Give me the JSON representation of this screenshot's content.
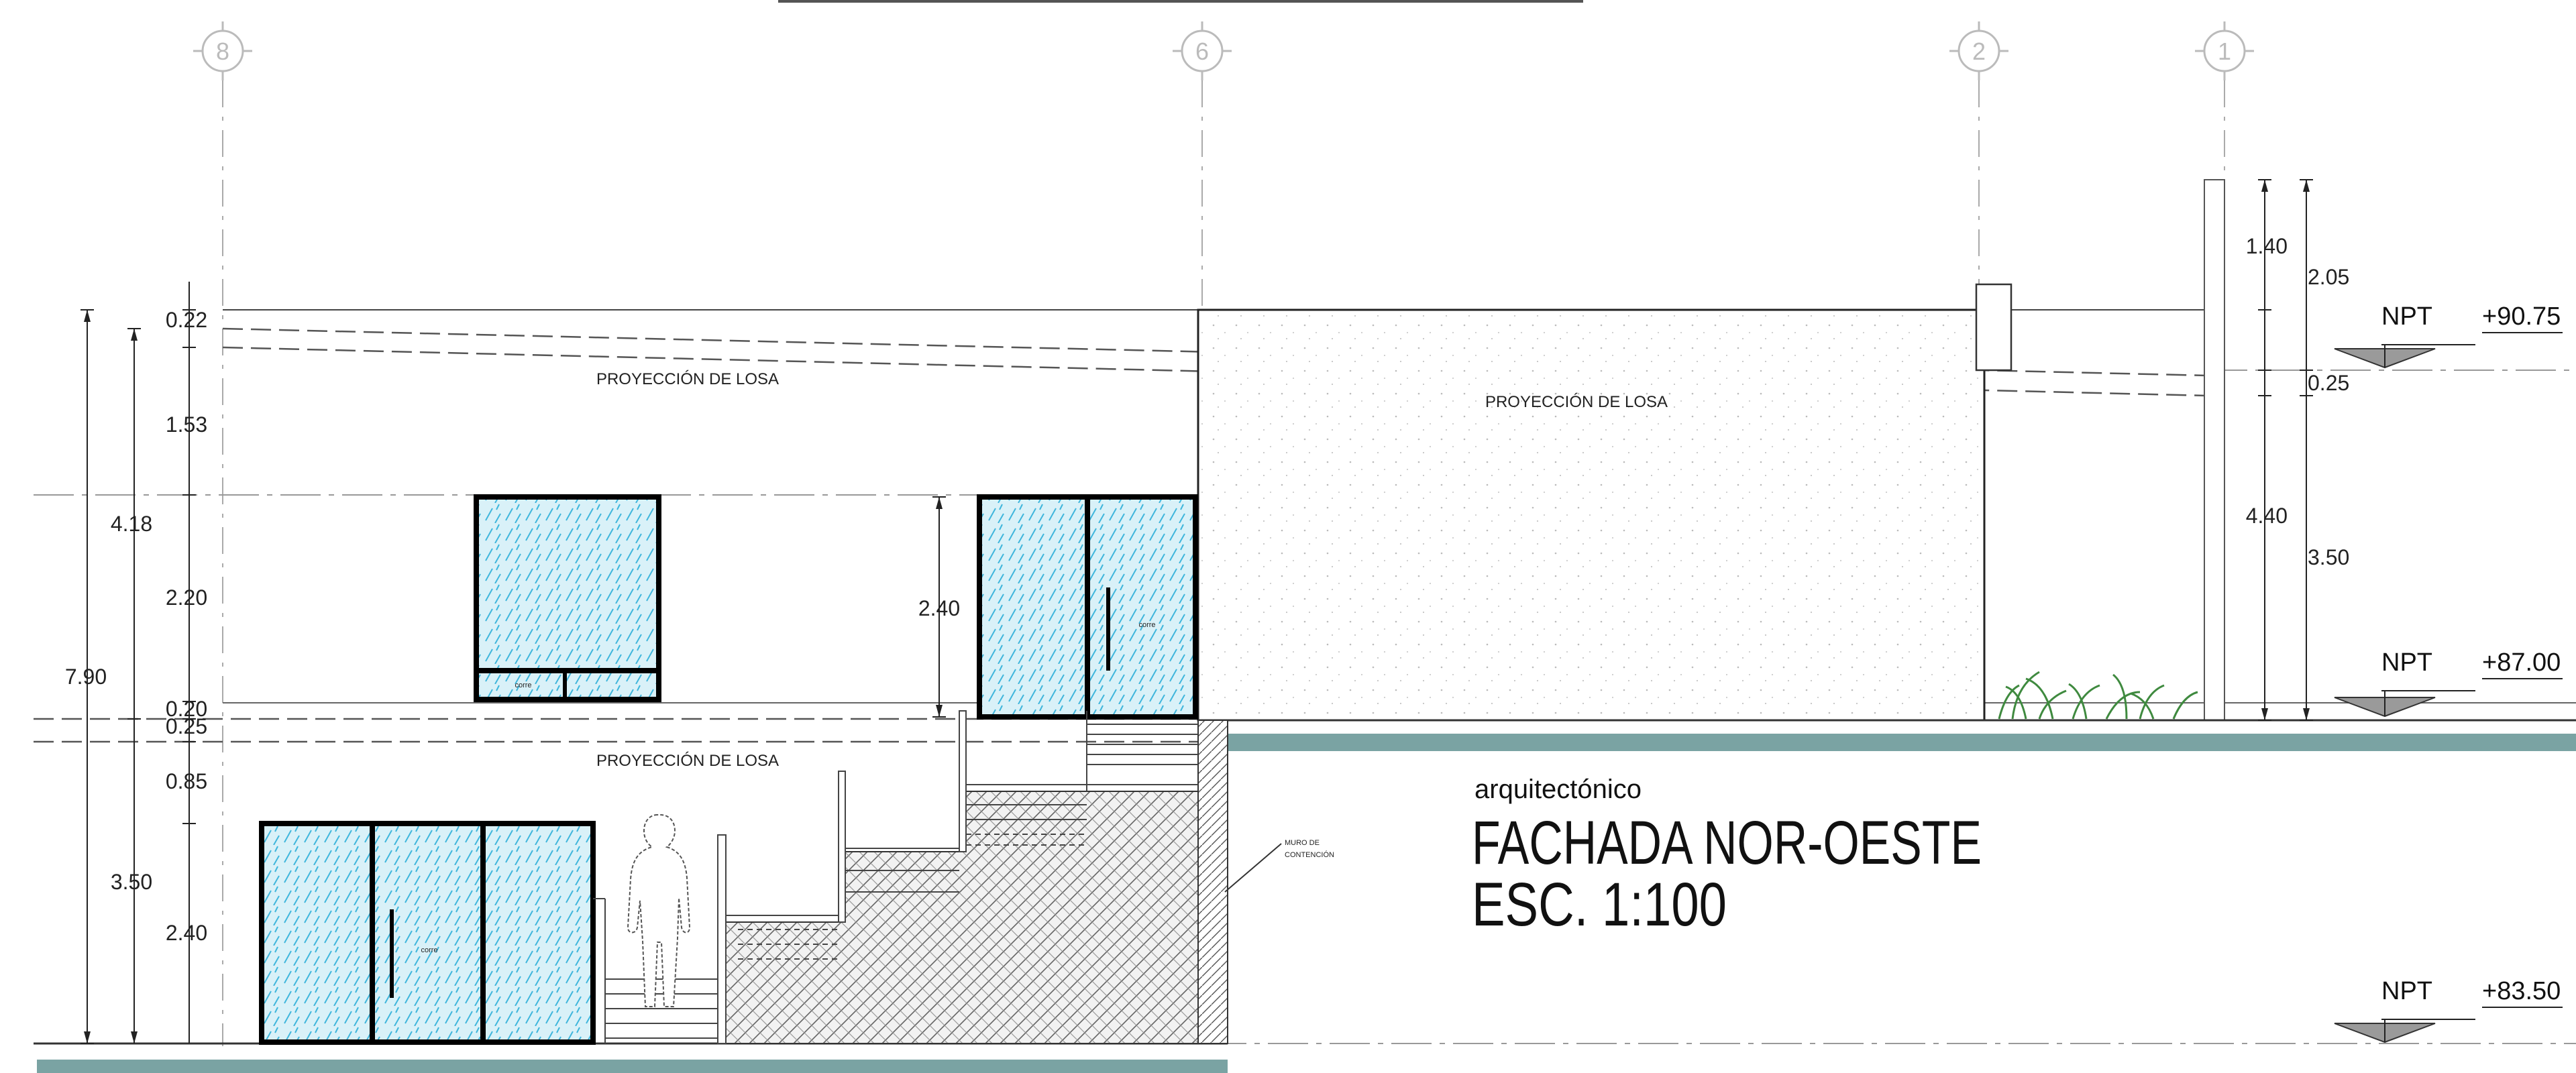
{
  "axes": [
    "8",
    "6",
    "2",
    "1"
  ],
  "colors": {
    "ground": "#7aa3a3",
    "glass": "#bfe6f2",
    "frame": "#000000",
    "line": "#333333"
  },
  "labels": {
    "losa_projection": "PROYECCIÓN DE LOSA",
    "corre": "corre",
    "muro_line1": "MURO DE",
    "muro_line2": "CONTENCIÓN"
  },
  "levels": [
    {
      "tag": "NPT",
      "value": "+90.75"
    },
    {
      "tag": "NPT",
      "value": "+87.00"
    },
    {
      "tag": "NPT",
      "value": "+83.50"
    }
  ],
  "dims_left": {
    "total": "7.90",
    "upper": "4.18",
    "d022": "0.22",
    "d153": "1.53",
    "d220": "2.20",
    "d020": "0.20",
    "d025": "0.25",
    "d085": "0.85",
    "d350": "3.50",
    "d240": "2.40"
  },
  "dims_mid": {
    "door": "2.40"
  },
  "dims_right": {
    "d140": "1.40",
    "d205": "2.05",
    "d025": "0.25",
    "d440": "4.40",
    "d350": "3.50"
  },
  "title": {
    "subtitle": "arquitectónico",
    "line1": "FACHADA NOR-OESTE",
    "line2": "ESC. 1:100"
  }
}
